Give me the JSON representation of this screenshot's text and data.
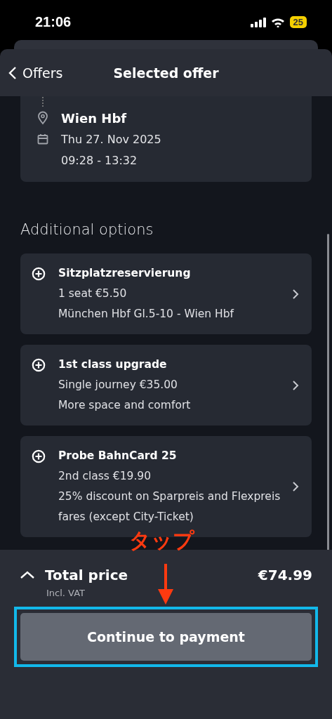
{
  "status_bar": {
    "time": "21:06",
    "battery": "25"
  },
  "header": {
    "back_label": "Offers",
    "title": "Selected offer"
  },
  "trip": {
    "destination": "Wien Hbf",
    "date": "Thu 27. Nov 2025",
    "time": "09:28 - 13:32"
  },
  "section_title": "Additional options",
  "options": [
    {
      "title": "Sitzplatzreservierung",
      "price_line": "1 seat €5.50",
      "description": "München Hbf Gl.5-10 - Wien Hbf"
    },
    {
      "title": "1st class upgrade",
      "price_line": "Single journey €35.00",
      "description": "More space and comfort"
    },
    {
      "title": "Probe BahnCard 25",
      "price_line": "2nd class €19.90",
      "description": "25% discount on Sparpreis and Flexpreis fares (except City-Ticket)"
    }
  ],
  "total": {
    "label": "Total price",
    "note": "Incl. VAT",
    "price": "€74.99"
  },
  "primary_button": "Continue to payment",
  "annotation": {
    "text": "タップ"
  }
}
